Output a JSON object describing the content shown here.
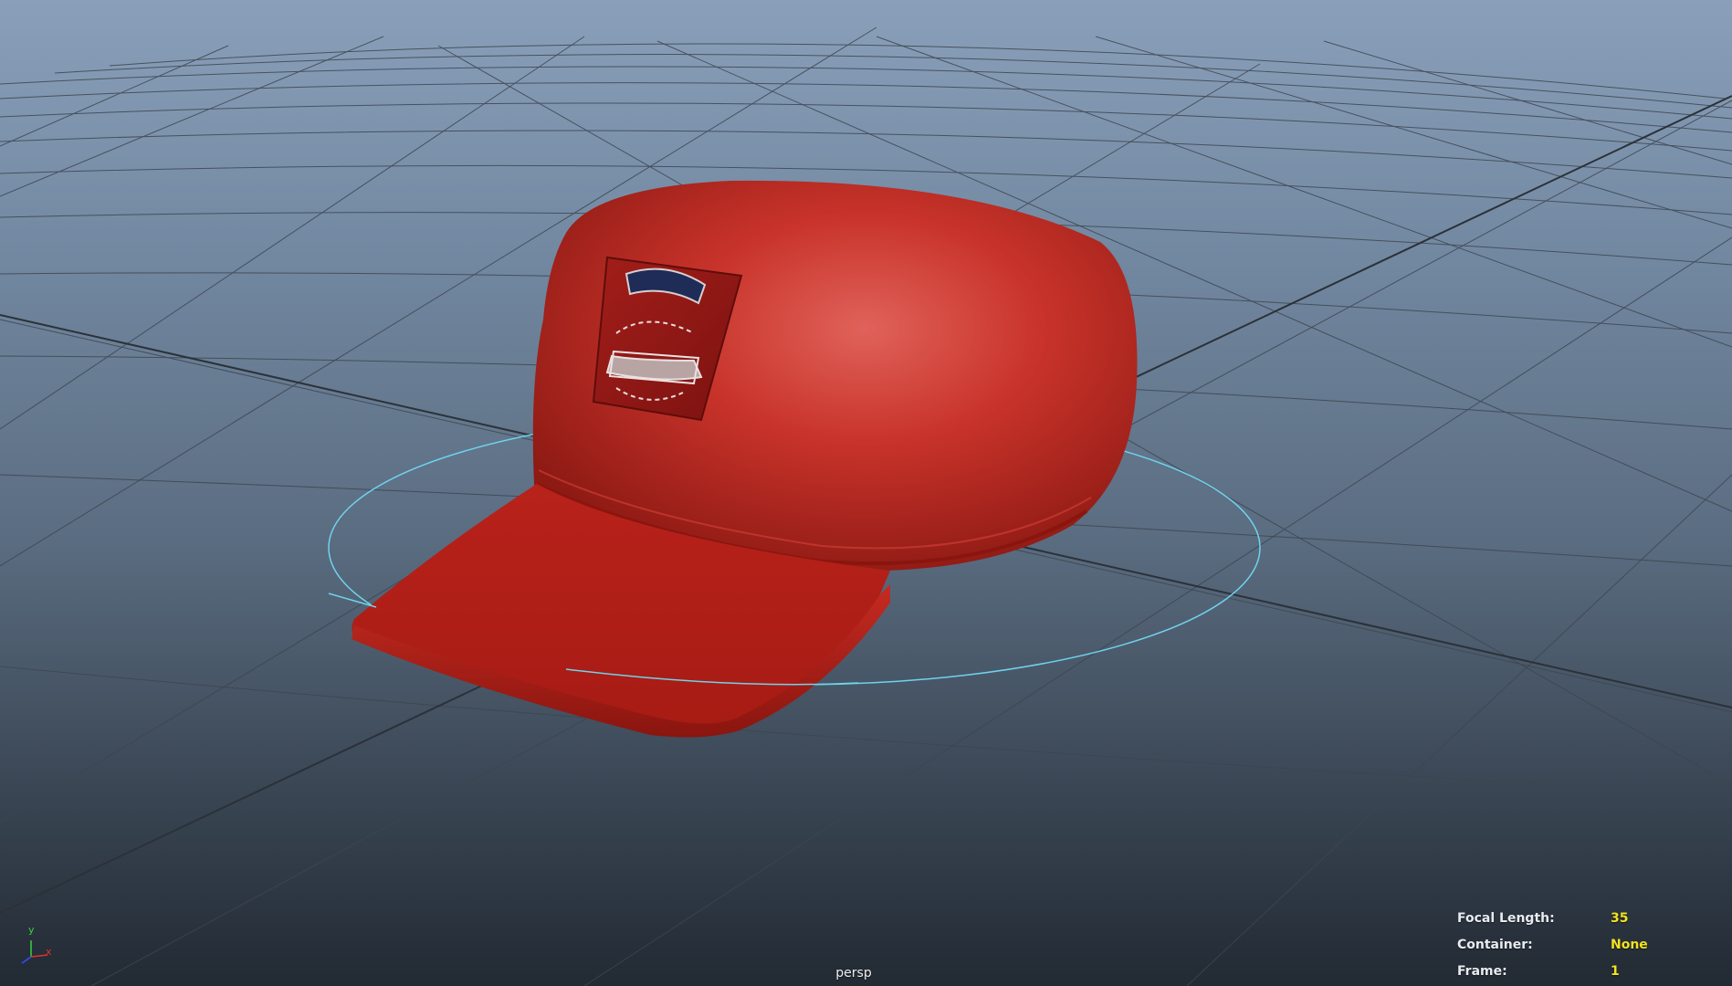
{
  "viewport": {
    "camera_name": "persp",
    "background_top": "#8aa0ba",
    "background_bottom": "#222a33",
    "grid_color": "#3d4650",
    "selection_color": "#6fd3ec",
    "model_color": "#c42a1f"
  },
  "hud": {
    "focal_length": {
      "label": "Focal Length:",
      "value": "35"
    },
    "container": {
      "label": "Container:",
      "value": "None"
    },
    "frame": {
      "label": "Frame:",
      "value": "1"
    }
  },
  "axis_gizmo": {
    "y_label": "y",
    "x_label": "x",
    "y_color": "#3ad13a",
    "x_color": "#e03030",
    "z_color": "#3050ff"
  },
  "model": {
    "name": "cap-model",
    "icon": "cap-mesh"
  }
}
